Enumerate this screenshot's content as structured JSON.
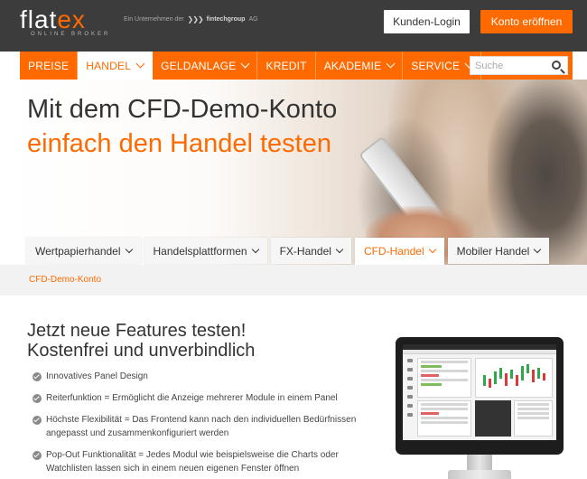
{
  "brand": {
    "logo_main": "flat",
    "logo_accent": "ex",
    "logo_tagline": "ONLINE BROKER",
    "partner_prefix": "Ein Unternehmen der",
    "partner_name": "fintechgroup",
    "partner_suffix": "AG"
  },
  "header": {
    "login_label": "Kunden-Login",
    "open_account_label": "Konto eröffnen"
  },
  "nav": {
    "items": [
      {
        "label": "PREISE",
        "dropdown": false,
        "active": false
      },
      {
        "label": "HANDEL",
        "dropdown": true,
        "active": true
      },
      {
        "label": "GELDANLAGE",
        "dropdown": true,
        "active": false
      },
      {
        "label": "KREDIT",
        "dropdown": false,
        "active": false
      },
      {
        "label": "AKADEMIE",
        "dropdown": true,
        "active": false
      },
      {
        "label": "SERVICE",
        "dropdown": true,
        "active": false
      }
    ],
    "search_placeholder": "Suche"
  },
  "hero": {
    "title_line1": "Mit dem CFD-Demo-Konto",
    "title_line2": "einfach den Handel testen"
  },
  "subtabs": [
    {
      "label": "Wertpapierhandel",
      "active": false
    },
    {
      "label": "Handelsplattformen",
      "active": false
    },
    {
      "label": "FX-Handel",
      "active": false
    },
    {
      "label": "CFD-Handel",
      "active": true
    },
    {
      "label": "Mobiler Handel",
      "active": false
    }
  ],
  "breadcrumb": {
    "current": "CFD-Demo-Konto"
  },
  "content": {
    "heading_line1": "Jetzt neue Features testen!",
    "heading_line2": "Kostenfrei und unverbindlich",
    "features": [
      "Innovatives Panel Design",
      "Reiterfunktion = Ermöglicht die Anzeige mehrerer Module in einem Panel",
      "Höchste Flexibilität = Das Frontend kann nach den individuellen Bedürfnissen angepasst und zusammenkonfiguriert werden",
      "Pop-Out Funktionalität = Jedes Modul wie beispielsweise die Charts oder Watchlisten lassen sich in einem neuen eigenen Fenster öffnen"
    ]
  },
  "colors": {
    "accent": "#ff6a00",
    "topbar": "#3c3c3c",
    "crumb_bg": "#f2f2f2"
  }
}
